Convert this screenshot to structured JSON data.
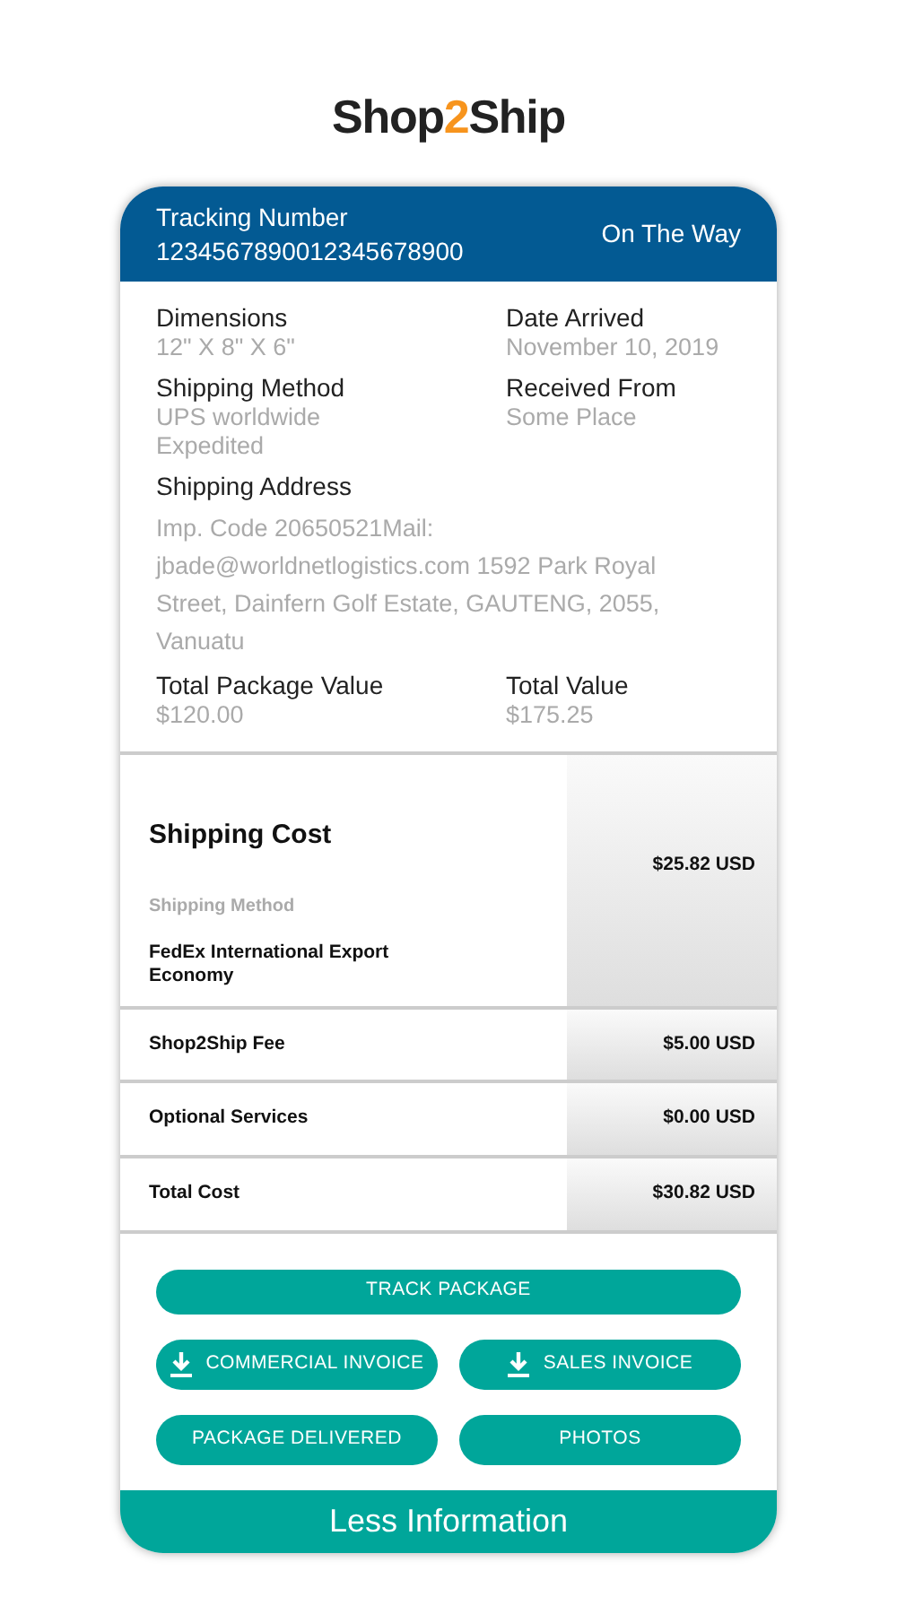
{
  "logo": {
    "before": "Shop",
    "accent": "2",
    "after": "Ship"
  },
  "header": {
    "label": "Tracking Number",
    "number": "1234567890012345678900",
    "status": "On The Way"
  },
  "details": [
    {
      "label": "Dimensions",
      "value": "12\" X 8\" X 6\"",
      "kind": "half"
    },
    {
      "label": "Date Arrived",
      "value": "November 10, 2019",
      "kind": "half"
    },
    {
      "label": "Shipping Method",
      "value": "UPS worldwide Expedited",
      "kind": "half"
    },
    {
      "label": "Received From",
      "value": "Some Place",
      "kind": "half"
    },
    {
      "label": "Shipping Address",
      "value": "Imp. Code 20650521Mail: jbade@worldnetlogistics.com 1592 Park Royal Street, Dainfern Golf Estate, GAUTENG, 2055, Vanuatu",
      "kind": "full"
    },
    {
      "label": "Total Package Value",
      "value": "$120.00",
      "kind": "half"
    },
    {
      "label": "Total Value",
      "value": "$175.25",
      "kind": "half"
    }
  ],
  "cost": {
    "title": "Shipping Cost",
    "subtitle": "Shipping Method",
    "rows": [
      {
        "label": "FedEx International Export Economy",
        "amount": "$25.82 USD"
      },
      {
        "label": "Shop2Ship Fee",
        "amount": "$5.00 USD"
      },
      {
        "label": "Optional Services",
        "amount": "$0.00 USD"
      },
      {
        "label": "Total Cost",
        "amount": "$30.82 USD"
      }
    ]
  },
  "buttons": [
    {
      "label": "TRACK PACKAGE",
      "kind": "full",
      "icon": false
    },
    {
      "label": "COMMERCIAL INVOICE",
      "kind": "half",
      "icon": true
    },
    {
      "label": "SALES INVOICE",
      "kind": "half",
      "icon": true
    },
    {
      "label": "PACKAGE DELIVERED",
      "kind": "half",
      "icon": false
    },
    {
      "label": "PHOTOS",
      "kind": "half",
      "icon": false
    }
  ],
  "footer": "Less Information"
}
